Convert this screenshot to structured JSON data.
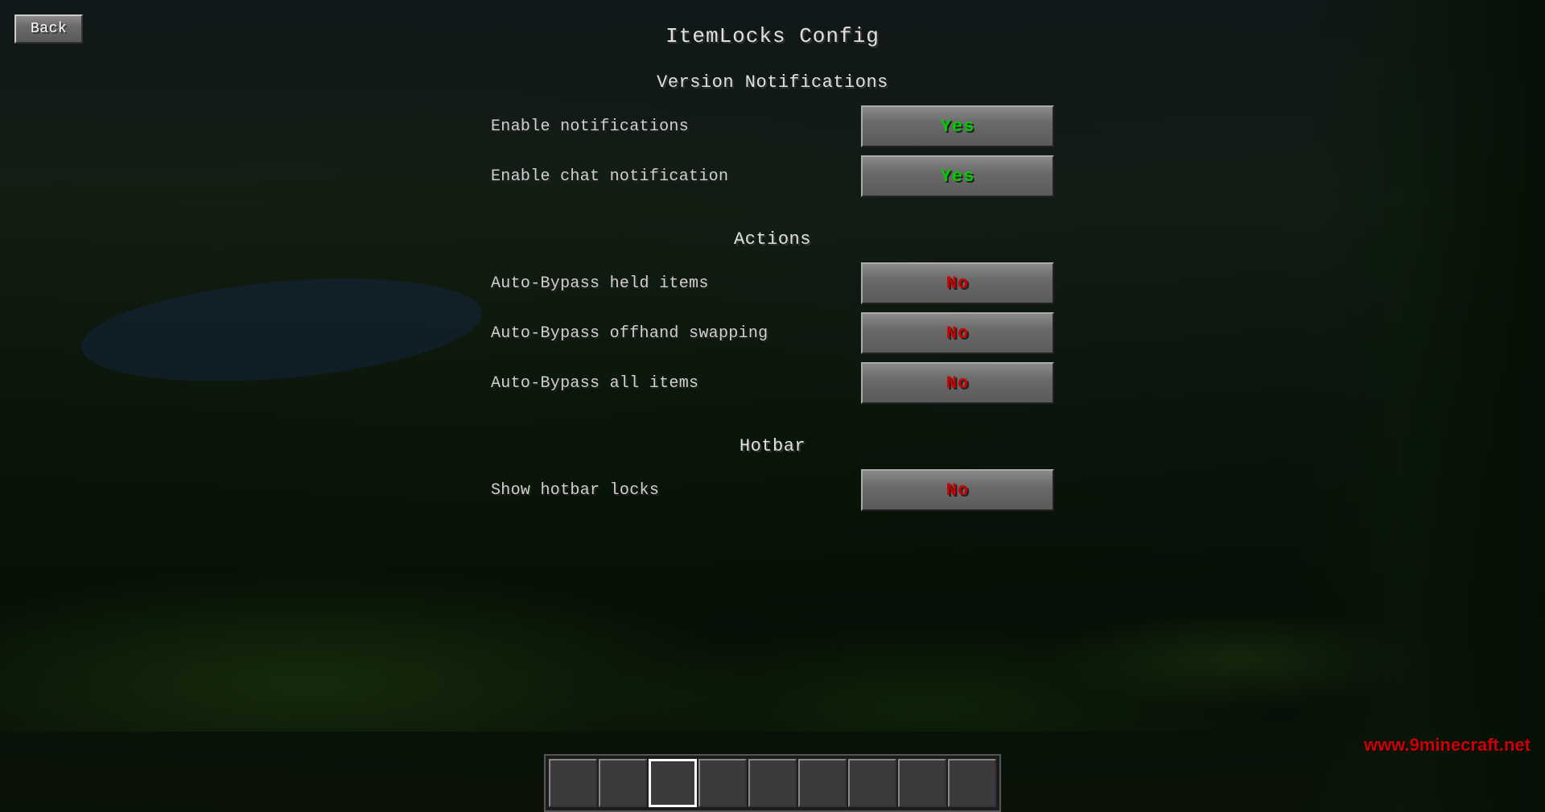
{
  "page": {
    "title": "ItemLocks Config",
    "back_label": "Back"
  },
  "sections": {
    "version_notifications": {
      "title": "Version Notifications",
      "rows": [
        {
          "label": "Enable notifications",
          "value": "Yes",
          "state": "yes"
        },
        {
          "label": "Enable chat notification",
          "value": "Yes",
          "state": "yes"
        }
      ]
    },
    "actions": {
      "title": "Actions",
      "rows": [
        {
          "label": "Auto-Bypass held items",
          "value": "No",
          "state": "no"
        },
        {
          "label": "Auto-Bypass offhand swapping",
          "value": "No",
          "state": "no"
        },
        {
          "label": "Auto-Bypass all items",
          "value": "No",
          "state": "no"
        }
      ]
    },
    "hotbar": {
      "title": "Hotbar",
      "rows": [
        {
          "label": "Show hotbar locks",
          "value": "No",
          "state": "no"
        }
      ]
    }
  },
  "watermark": "www.9minecraft.net"
}
